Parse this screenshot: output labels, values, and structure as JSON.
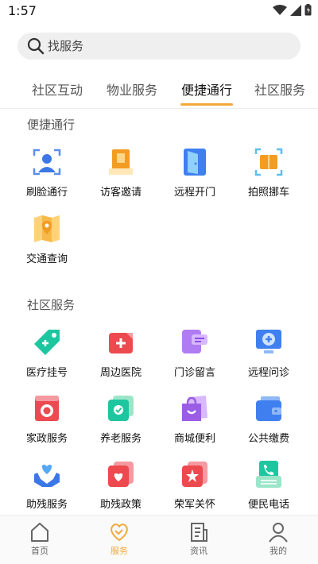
{
  "status_bar": {
    "time": "1:57"
  },
  "search": {
    "placeholder": "找服务"
  },
  "tabs": [
    {
      "label": "社区互动",
      "active": false
    },
    {
      "label": "物业服务",
      "active": false
    },
    {
      "label": "便捷通行",
      "active": true
    },
    {
      "label": "社区服务",
      "active": false
    }
  ],
  "sections": {
    "convenient": {
      "title": "便捷通行",
      "items": [
        {
          "label": "刷脸通行",
          "icon": "face-scan-icon"
        },
        {
          "label": "访客邀请",
          "icon": "visitor-invite-icon"
        },
        {
          "label": "远程开门",
          "icon": "door-open-icon"
        },
        {
          "label": "拍照挪车",
          "icon": "photo-car-icon"
        },
        {
          "label": "交通查询",
          "icon": "map-pin-icon"
        }
      ]
    },
    "community": {
      "title": "社区服务",
      "items": [
        {
          "label": "医疗挂号",
          "icon": "medical-tag-icon"
        },
        {
          "label": "周边医院",
          "icon": "hospital-icon"
        },
        {
          "label": "门诊留言",
          "icon": "chat-message-icon"
        },
        {
          "label": "远程问诊",
          "icon": "remote-consult-icon"
        },
        {
          "label": "家政服务",
          "icon": "washing-machine-icon"
        },
        {
          "label": "养老服务",
          "icon": "elderly-care-icon"
        },
        {
          "label": "商城便利",
          "icon": "shopping-bag-icon"
        },
        {
          "label": "公共缴费",
          "icon": "wallet-icon"
        },
        {
          "label": "助残服务",
          "icon": "heart-hands-icon"
        },
        {
          "label": "助残政策",
          "icon": "heart-doc-icon"
        },
        {
          "label": "荣军关怀",
          "icon": "star-badge-icon"
        },
        {
          "label": "便民电话",
          "icon": "phone-icon"
        }
      ]
    }
  },
  "bottom_nav": [
    {
      "label": "首页",
      "icon": "home-icon",
      "active": false
    },
    {
      "label": "服务",
      "icon": "service-heart-icon",
      "active": true
    },
    {
      "label": "资讯",
      "icon": "news-icon",
      "active": false
    },
    {
      "label": "我的",
      "icon": "profile-icon",
      "active": false
    }
  ],
  "colors": {
    "accent": "#f2a93b",
    "tab_underline": "#f2a93b"
  }
}
